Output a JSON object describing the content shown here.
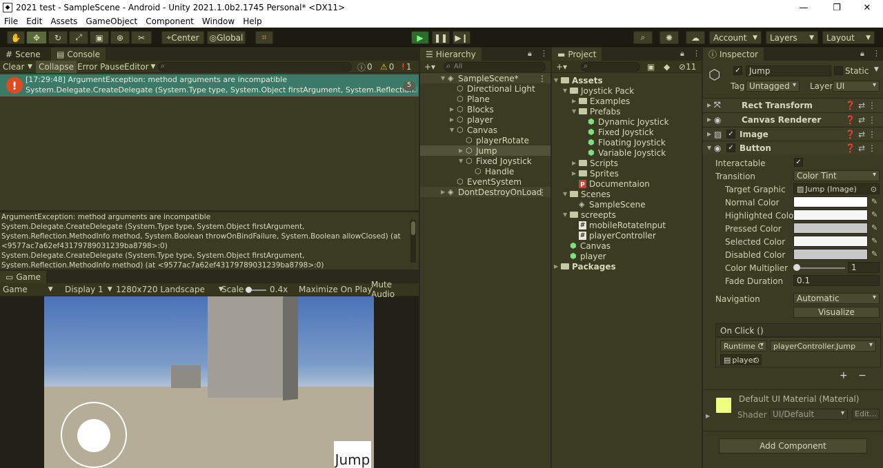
{
  "window": {
    "title": "2021 test - SampleScene - Android - Unity 2021.1.0b2.1745 Personal* <DX11>",
    "controls": [
      "minimize-icon",
      "maximize-icon",
      "close-icon"
    ]
  },
  "menu": [
    "File",
    "Edit",
    "Assets",
    "GameObject",
    "Component",
    "Window",
    "Help"
  ],
  "toolbar": {
    "center_label": "Center",
    "global_label": "Global",
    "account_label": "Account",
    "layers_label": "Layers",
    "layout_label": "Layout"
  },
  "console": {
    "tab_scene": "Scene",
    "tab_console": "Console",
    "clear": "Clear",
    "collapse": "Collapse",
    "error_pause": "Error Pause",
    "editor": "Editor",
    "count_log": "0",
    "count_warn": "0",
    "count_err": "1",
    "entry_line1": "[17:29:48] ArgumentException: method arguments are incompatible",
    "entry_line2": "System.Delegate.CreateDelegate (System.Type type, System.Object firstArgument, System.Reflection.Metho",
    "entry_count": "5",
    "detail": [
      "ArgumentException: method arguments are incompatible",
      "System.Delegate.CreateDelegate (System.Type type, System.Object firstArgument,",
      "System.Reflection.MethodInfo method, System.Boolean throwOnBindFailure, System.Boolean allowClosed) (at",
      "<9577ac7a62ef43179789031239ba8798>:0)",
      "System.Delegate.CreateDelegate (System.Type type, System.Object firstArgument,",
      "System.Reflection.MethodInfo method) (at <9577ac7a62ef43179789031239ba8798>:0)"
    ]
  },
  "game": {
    "tab": "Game",
    "mode": "Game",
    "display": "Display 1",
    "resolution": "1280x720 Landscape",
    "scale_label": "Scale",
    "scale_value": "0.4x",
    "maximize": "Maximize On Play",
    "mute": "Mute Audio",
    "jump_button": "Jump"
  },
  "hierarchy": {
    "tab": "Hierarchy",
    "search_placeholder": "All",
    "items": [
      {
        "label": "SampleScene*",
        "depth": 0,
        "kind": "scene",
        "expanded": true
      },
      {
        "label": "Directional Light",
        "depth": 1,
        "kind": "cube"
      },
      {
        "label": "Plane",
        "depth": 1,
        "kind": "cube"
      },
      {
        "label": "Blocks",
        "depth": 1,
        "kind": "cube",
        "collapsed": true
      },
      {
        "label": "player",
        "depth": 1,
        "kind": "cube",
        "collapsed": true
      },
      {
        "label": "Canvas",
        "depth": 1,
        "kind": "cube",
        "expanded": true
      },
      {
        "label": "playerRotate",
        "depth": 2,
        "kind": "cube"
      },
      {
        "label": "Jump",
        "depth": 2,
        "kind": "cube",
        "collapsed": true,
        "selected": true
      },
      {
        "label": "Fixed Joystick",
        "depth": 2,
        "kind": "cube",
        "expanded": true
      },
      {
        "label": "Handle",
        "depth": 3,
        "kind": "cube"
      },
      {
        "label": "EventSystem",
        "depth": 1,
        "kind": "cube"
      },
      {
        "label": "DontDestroyOnLoad",
        "depth": 0,
        "kind": "scene",
        "collapsed": true
      }
    ]
  },
  "project": {
    "tab": "Project",
    "hidden_count": "11",
    "items": [
      {
        "label": "Assets",
        "depth": 0,
        "kind": "folder",
        "expanded": true,
        "bold": true
      },
      {
        "label": "Joystick Pack",
        "depth": 1,
        "kind": "folder",
        "expanded": true
      },
      {
        "label": "Examples",
        "depth": 2,
        "kind": "folder",
        "collapsed": true
      },
      {
        "label": "Prefabs",
        "depth": 2,
        "kind": "folder",
        "expanded": true
      },
      {
        "label": "Dynamic Joystick",
        "depth": 3,
        "kind": "prefab"
      },
      {
        "label": "Fixed Joystick",
        "depth": 3,
        "kind": "prefab"
      },
      {
        "label": "Floating Joystick",
        "depth": 3,
        "kind": "prefab"
      },
      {
        "label": "Variable Joystick",
        "depth": 3,
        "kind": "prefab"
      },
      {
        "label": "Scripts",
        "depth": 2,
        "kind": "folder",
        "collapsed": true
      },
      {
        "label": "Sprites",
        "depth": 2,
        "kind": "folder",
        "collapsed": true
      },
      {
        "label": "Documentaion",
        "depth": 2,
        "kind": "pdf"
      },
      {
        "label": "Scenes",
        "depth": 1,
        "kind": "folder",
        "expanded": true
      },
      {
        "label": "SampleScene",
        "depth": 2,
        "kind": "scene"
      },
      {
        "label": "screepts",
        "depth": 1,
        "kind": "folder",
        "expanded": true
      },
      {
        "label": "mobileRotateInput",
        "depth": 2,
        "kind": "script"
      },
      {
        "label": "playerController",
        "depth": 2,
        "kind": "script"
      },
      {
        "label": "Canvas",
        "depth": 1,
        "kind": "prefab"
      },
      {
        "label": "player",
        "depth": 1,
        "kind": "prefab"
      },
      {
        "label": "Packages",
        "depth": 0,
        "kind": "folder",
        "collapsed": true,
        "bold": true
      }
    ]
  },
  "inspector": {
    "tab": "Inspector",
    "object_name": "Jump",
    "static_label": "Static",
    "tag_label": "Tag",
    "tag_value": "Untagged",
    "layer_label": "Layer",
    "layer_value": "UI",
    "components": [
      "Rect Transform",
      "Canvas Renderer",
      "Image",
      "Button"
    ],
    "button": {
      "interactable": "Interactable",
      "transition": "Transition",
      "transition_value": "Color Tint",
      "target_graphic": "Target Graphic",
      "target_graphic_value": "Jump (Image)",
      "normal_color": "Normal Color",
      "highlighted_color": "Highlighted Color",
      "pressed_color": "Pressed Color",
      "selected_color": "Selected Color",
      "disabled_color": "Disabled Color",
      "color_multiplier": "Color Multiplier",
      "color_multiplier_value": "1",
      "fade_duration": "Fade Duration",
      "fade_duration_value": "0.1",
      "navigation": "Navigation",
      "navigation_value": "Automatic",
      "visualize": "Visualize",
      "on_click": "On Click ()",
      "runtime": "Runtime C",
      "function": "playerController.Jump",
      "target_object": "player"
    },
    "colors": {
      "normal": "#ffffff",
      "highlighted": "#f5f5f5",
      "pressed": "#c8c8c8",
      "selected": "#f5f5f5",
      "disabled": "#c8c8c8"
    },
    "material_name": "Default UI Material (Material)",
    "shader_label": "Shader",
    "shader_value": "UI/Default",
    "edit_label": "Edit...",
    "add_component": "Add Component"
  }
}
